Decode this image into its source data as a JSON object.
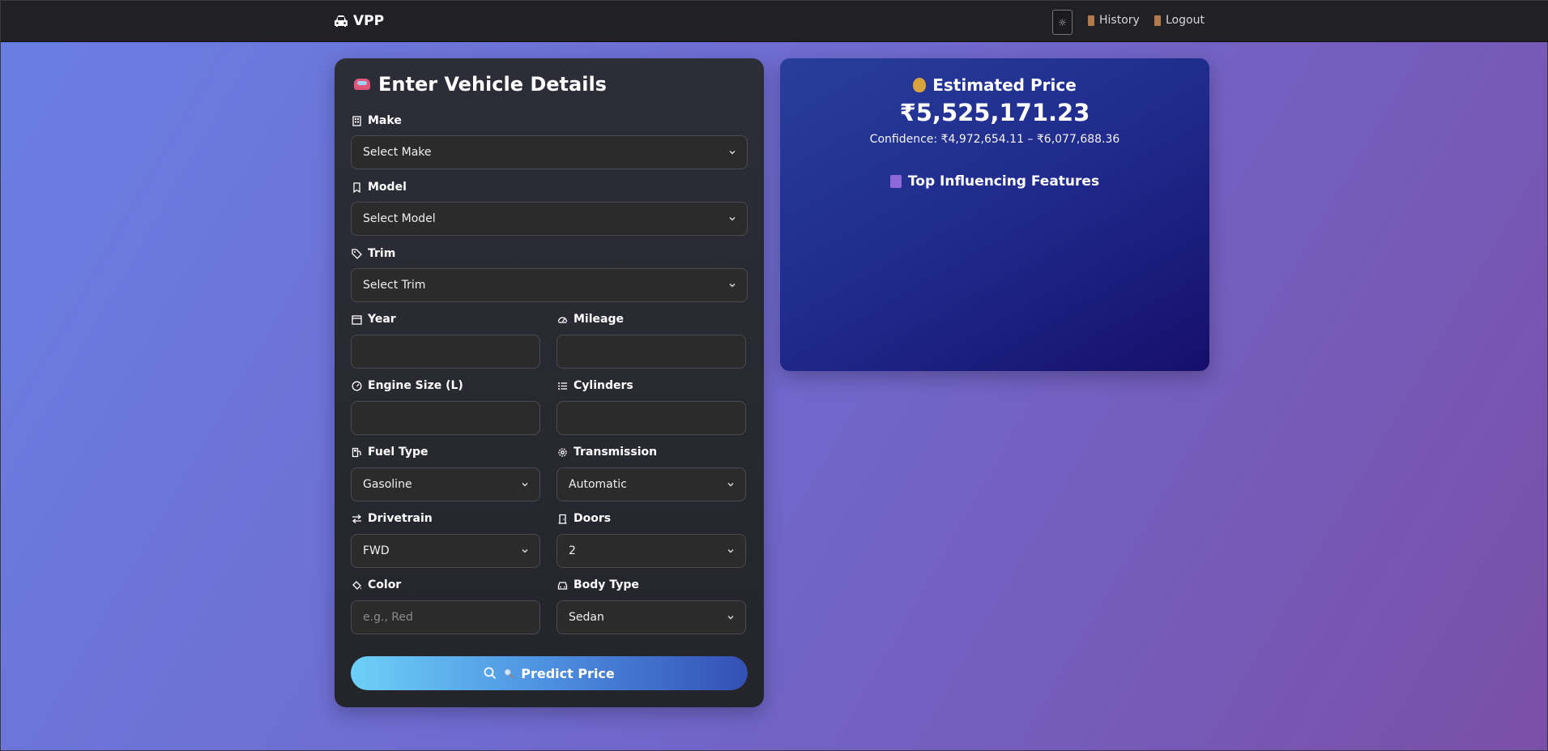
{
  "nav": {
    "brand": "VPP",
    "theme_icon": "sun-icon",
    "history_label": "History",
    "logout_label": "Logout"
  },
  "form": {
    "title": "Enter Vehicle Details",
    "make": {
      "label": "Make",
      "value": "Select Make"
    },
    "model": {
      "label": "Model",
      "value": "Select Model"
    },
    "trim": {
      "label": "Trim",
      "value": "Select Trim"
    },
    "year": {
      "label": "Year",
      "value": ""
    },
    "mileage": {
      "label": "Mileage",
      "value": ""
    },
    "engine_size": {
      "label": "Engine Size (L)",
      "value": ""
    },
    "cylinders": {
      "label": "Cylinders",
      "value": ""
    },
    "fuel_type": {
      "label": "Fuel Type",
      "value": "Gasoline"
    },
    "transmission": {
      "label": "Transmission",
      "value": "Automatic"
    },
    "drivetrain": {
      "label": "Drivetrain",
      "value": "FWD"
    },
    "doors": {
      "label": "Doors",
      "value": "2"
    },
    "color": {
      "label": "Color",
      "placeholder": "e.g., Red"
    },
    "body_type": {
      "label": "Body Type",
      "value": "Sedan"
    },
    "predict_label": "Predict Price"
  },
  "result": {
    "title": "Estimated Price",
    "price": "₹5,525,171.23",
    "confidence": "Confidence: ₹4,972,654.11 – ₹6,077,688.36",
    "features_title": "Top Influencing Features"
  },
  "colors": {
    "accent_gradient_start": "#6dd0f7",
    "accent_gradient_end": "#3350b5",
    "result_card": "#1f2a8c",
    "form_card": "#2c2d37"
  }
}
